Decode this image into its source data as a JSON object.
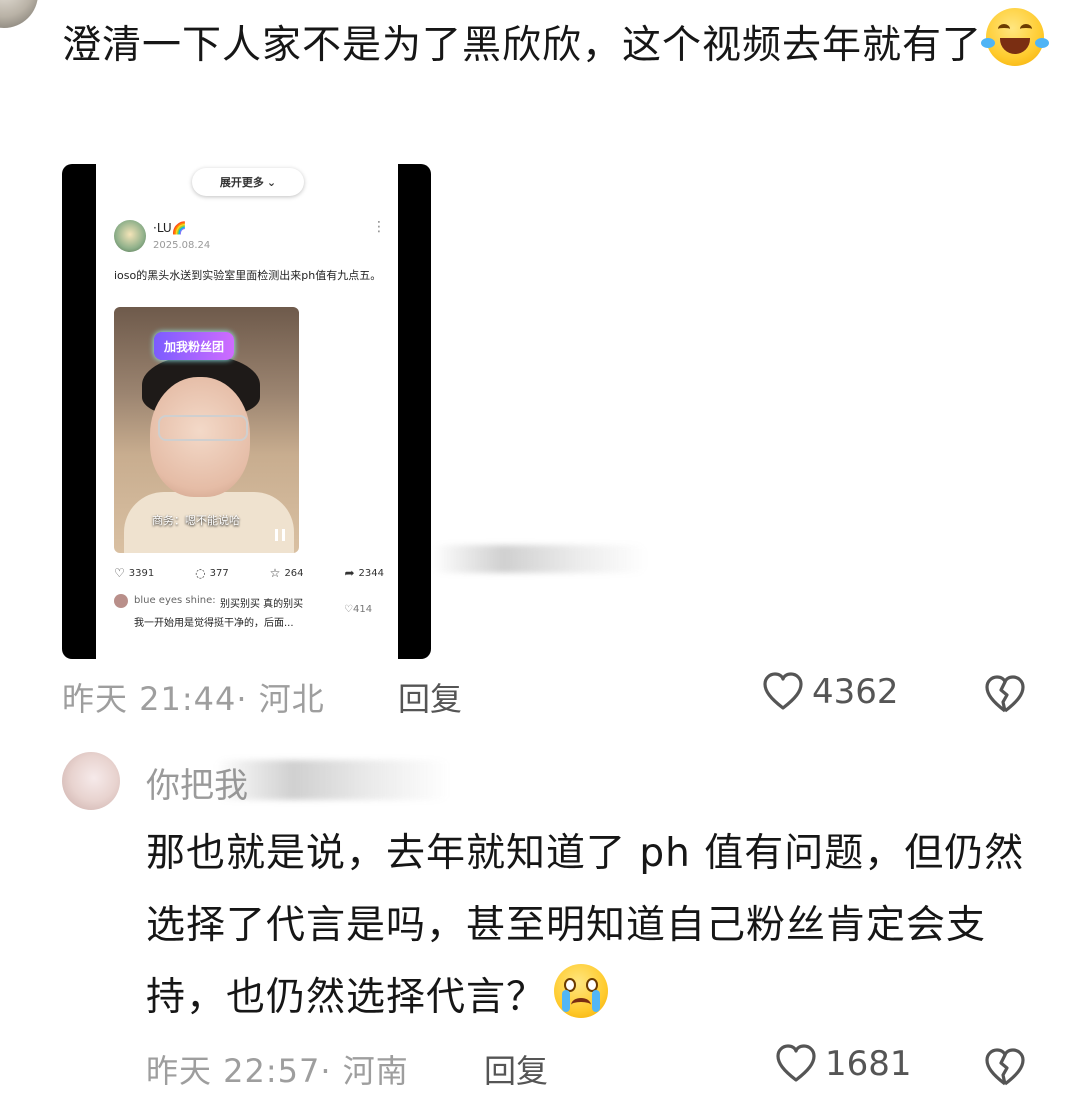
{
  "comment1": {
    "text": "澄清一下人家不是为了黑欣欣，这个视频去年就有了",
    "emoji": "face-with-tears-of-joy",
    "time": "昨天 21:44",
    "location": "· 河北",
    "reply_label": "回复",
    "likes": "4362"
  },
  "embed": {
    "expand_label": "展开更多",
    "user": "·LU🌈",
    "date": "2025.08.24",
    "text": "ioso的黑头水送到实验室里面检测出来ph值有九点五。",
    "badge": "加我粉丝团",
    "video_caption": "商务：嗯不能说哈",
    "stats": {
      "likes": "3391",
      "comments": "377",
      "favorites": "264",
      "shares": "2344"
    },
    "sub_comment": {
      "user": "blue eyes shine:",
      "line1": "别买别买 真的别买",
      "line2": "我一开始用是觉得挺干净的，后面...",
      "likes": "414"
    }
  },
  "comment2": {
    "name": "你把我",
    "text": "那也就是说，去年就知道了 ph 值有问题，但仍然选择了代言是吗，甚至明知道自己粉丝肯定会支持，也仍然选择代言？",
    "emoji": "crying-face",
    "time": "昨天 22:57",
    "location": "· 河南",
    "reply_label": "回复",
    "likes": "1681"
  }
}
